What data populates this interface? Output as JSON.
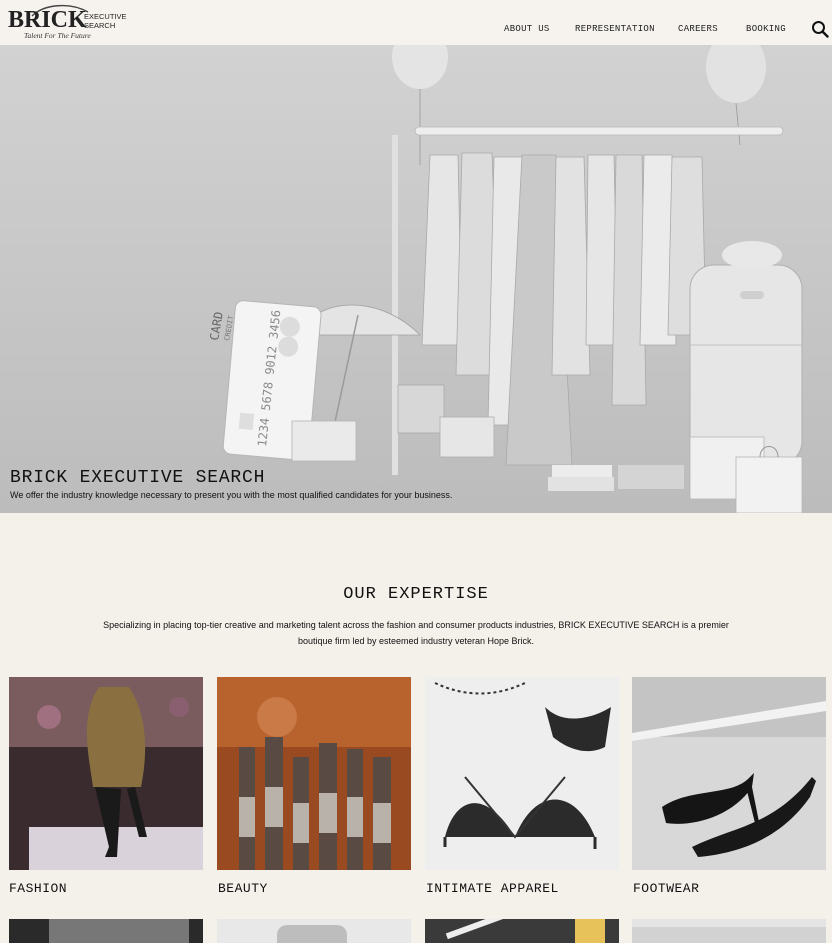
{
  "header": {
    "logo_word": "BRICK",
    "logo_side_line1": "EXECUTIVE",
    "logo_side_line2": "SEARCH",
    "logo_tagline": "Talent For The Future",
    "nav": [
      "ABOUT US",
      "REPRESENTATION",
      "CAREERS",
      "BOOKING"
    ],
    "search_icon": "search-icon"
  },
  "hero": {
    "title": "BRICK EXECUTIVE SEARCH",
    "subtitle": "We offer the industry knowledge necessary to present you with the most qualified candidates for your business.",
    "card_text_1": "CARD",
    "card_text_2": "CREDIT",
    "card_number": "1234 5678 9012 3456"
  },
  "expertise": {
    "title": "OUR EXPERTISE",
    "description": "Specializing in placing top-tier creative and marketing talent across the fashion and consumer products industries, BRICK EXECUTIVE SEARCH is a premier boutique firm led by esteemed industry veteran Hope Brick.",
    "categories": [
      "FASHION",
      "BEAUTY",
      "INTIMATE APPAREL",
      "FOOTWEAR"
    ]
  },
  "colors": {
    "page_bg": "#f4f0ea",
    "header_bg": "#f6f3ee",
    "text": "#111111"
  }
}
